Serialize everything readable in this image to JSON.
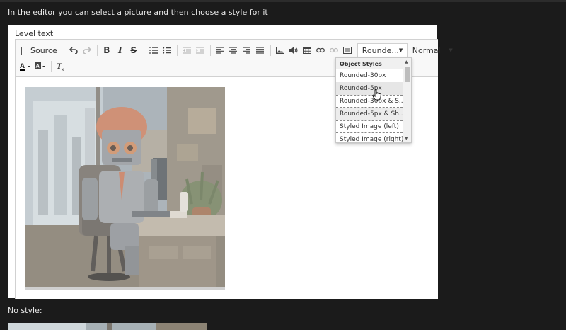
{
  "page": {
    "intro": "In the editor you can select a picture and then choose a style for it",
    "no_style": "No style:"
  },
  "panel": {
    "label": "Level text"
  },
  "toolbar": {
    "source_label": "Source",
    "bold_label": "B",
    "italic_label": "I",
    "strike_label": "S",
    "styles_value": "Rounde...",
    "format_value": "Normal"
  },
  "dropdown": {
    "header": "Object Styles",
    "items": [
      "Rounded-30px",
      "Rounded-5px",
      "Rounded-30px & S...",
      "Rounded-5px & Sh...",
      "Styled Image (left)",
      "Styled Image (right)"
    ]
  },
  "colors": {
    "page_bg": "#1b1b1b",
    "toolbar_bg": "#f8f8f8",
    "border": "#d1d1d1"
  }
}
